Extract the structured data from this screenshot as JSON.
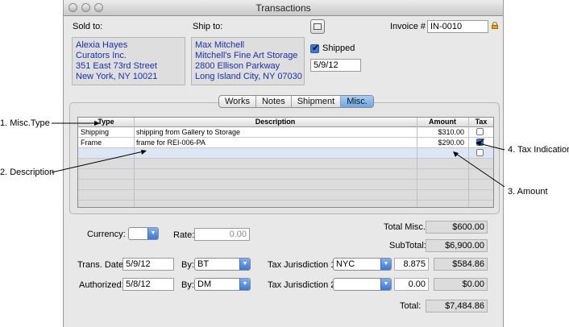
{
  "window": {
    "title": "Transactions"
  },
  "sold_to": {
    "label": "Sold to:",
    "lines": [
      "Alexia Hayes",
      "Curators Inc.",
      "351 East 73rd Street",
      "New York, NY 10021"
    ]
  },
  "ship_to": {
    "label": "Ship to:",
    "lines": [
      "Max Mitchell",
      "Mitchell's Fine Art Storage",
      "2800 Ellison Parkway",
      "Long Island City, NY 07030"
    ]
  },
  "shipped": {
    "label": "Shipped",
    "checked": true,
    "date": "5/9/12"
  },
  "invoice": {
    "label": "Invoice #",
    "value": "IN-0010"
  },
  "tabs": [
    {
      "label": "Works",
      "active": false
    },
    {
      "label": "Notes",
      "active": false
    },
    {
      "label": "Shipment",
      "active": false
    },
    {
      "label": "Misc.",
      "active": true
    }
  ],
  "table": {
    "headers": {
      "type": "Type",
      "description": "Description",
      "amount": "Amount",
      "tax": "Tax"
    },
    "rows": [
      {
        "type": "Shipping",
        "description": "shipping from Gallery to Storage",
        "amount": "$310.00",
        "tax": false
      },
      {
        "type": "Frame",
        "description": "frame for REI-006-PA",
        "amount": "$290.00",
        "tax": true
      }
    ]
  },
  "annotations": {
    "misc_type": "1. Misc.Type",
    "description": "2. Description",
    "amount": "3. Amount",
    "tax_indication": "4. Tax Indication"
  },
  "currency": {
    "label": "Currency:",
    "value": ""
  },
  "rate": {
    "label": "Rate:",
    "value": "0.00"
  },
  "totals": {
    "total_misc_label": "Total Misc.:",
    "total_misc": "$600.00",
    "subtotal_label": "SubTotal:",
    "subtotal": "$6,900.00",
    "total_label": "Total:",
    "total": "$7,484.86"
  },
  "trans_date": {
    "label": "Trans. Date:",
    "value": "5/9/12",
    "by_label": "By:",
    "by": "BT"
  },
  "authorized": {
    "label": "Authorized:",
    "value": "5/8/12",
    "by_label": "By:",
    "by": "DM"
  },
  "tax1": {
    "label": "Tax Jurisdiction 1:",
    "value": "NYC",
    "rate": "8.875",
    "amount": "$584.86"
  },
  "tax2": {
    "label": "Tax Jurisdiction 2:",
    "value": "",
    "rate": "0.00",
    "amount": "$0.00"
  },
  "colors": {
    "address_text": "#1a2fb0",
    "active_tab": "#6ea6e5"
  }
}
